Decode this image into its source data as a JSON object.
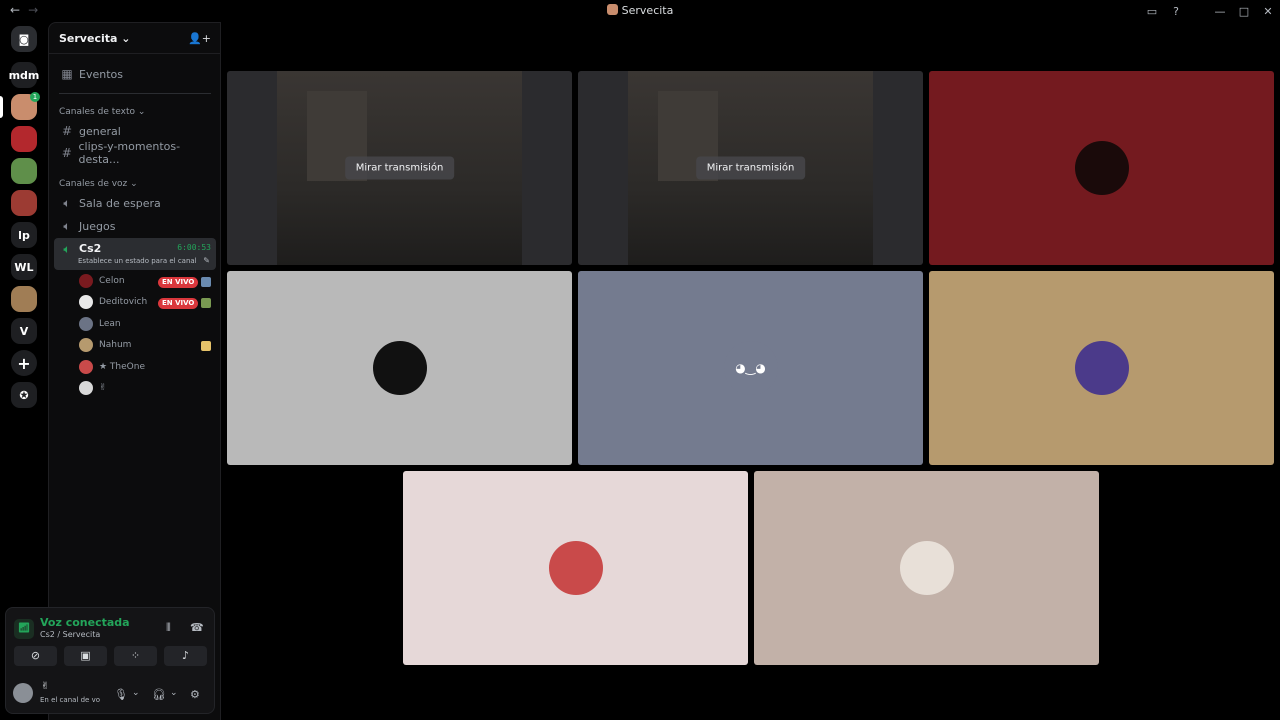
{
  "titlebar": {
    "title": "Servecita",
    "back_icon": "arrow-left-icon",
    "forward_icon": "arrow-right-icon",
    "inbox_icon": "inbox-icon",
    "help_icon": "help-icon"
  },
  "rail": {
    "servers": [
      {
        "label": "",
        "icon": "discord-home-icon",
        "color": "#2b2d31"
      },
      {
        "label": "mdm",
        "color": "#1e1f22"
      },
      {
        "label": "",
        "color": "#c98d6d",
        "badge": "1",
        "active": true
      },
      {
        "label": "",
        "color": "#b3282d"
      },
      {
        "label": "",
        "color": "#5f8f4a"
      },
      {
        "label": "",
        "color": "#9c3b33"
      },
      {
        "label": "lp",
        "color": "#1e1f22"
      },
      {
        "label": "WL",
        "color": "#1e1f22"
      },
      {
        "label": "",
        "color": "#a07d55"
      },
      {
        "label": "V",
        "color": "#1e1f22"
      },
      {
        "label": "+",
        "color": "#1e1f22"
      },
      {
        "label": "",
        "icon": "compass-icon",
        "color": "#1e1f22"
      }
    ]
  },
  "sidebar": {
    "server_name": "Servecita",
    "events_label": "Eventos",
    "text_category": "Canales de texto",
    "text_channels": [
      "general",
      "clips-y-momentos-desta..."
    ],
    "voice_category": "Canales de voz",
    "voice_channels": [
      "Sala de espera",
      "Juegos"
    ],
    "active_channel": {
      "name": "Cs2",
      "timer": "6:00:53",
      "status": "Establece un estado para el canal"
    },
    "members": [
      {
        "name": "Celon",
        "live": "EN VIVO",
        "color": "#7a1a1f"
      },
      {
        "name": "Deditovich",
        "live": "EN VIVO",
        "color": "#e8e8e8"
      },
      {
        "name": "Lean",
        "live": "",
        "color": "#6b7385"
      },
      {
        "name": "Nahum",
        "live": "",
        "color": "#b69a6e"
      },
      {
        "name": "★ TheOne",
        "live": "",
        "color": "#c94a4a"
      },
      {
        "name": "✌",
        "live": "",
        "color": "#d9d9d9"
      }
    ]
  },
  "voice_panel": {
    "title": "Voz conectada",
    "subtitle": "Cs2 / Servecita",
    "user_name": "✌",
    "user_status": "En el canal de voz"
  },
  "stage": {
    "watch_label": "Mirar transmisión",
    "tiles": [
      {
        "type": "stream",
        "bg": "#2b2b2e"
      },
      {
        "type": "stream",
        "bg": "#2b2b2e"
      },
      {
        "type": "avatar",
        "bg": "#741a1f",
        "avatar_color": "#1a0a0a"
      },
      {
        "type": "avatar",
        "bg": "#b9b9b9",
        "avatar_color": "#111111"
      },
      {
        "type": "avatar",
        "bg": "#747b8f",
        "avatar_color": "#747b8f",
        "icon": "discord-icon"
      },
      {
        "type": "avatar",
        "bg": "#b69a6e",
        "avatar_color": "#4b3a8a"
      },
      {
        "type": "avatar",
        "bg": "#e6d8d8",
        "avatar_color": "#c94a4a"
      },
      {
        "type": "avatar",
        "bg": "#c2b1a8",
        "avatar_color": "#e8e0d8"
      }
    ]
  }
}
